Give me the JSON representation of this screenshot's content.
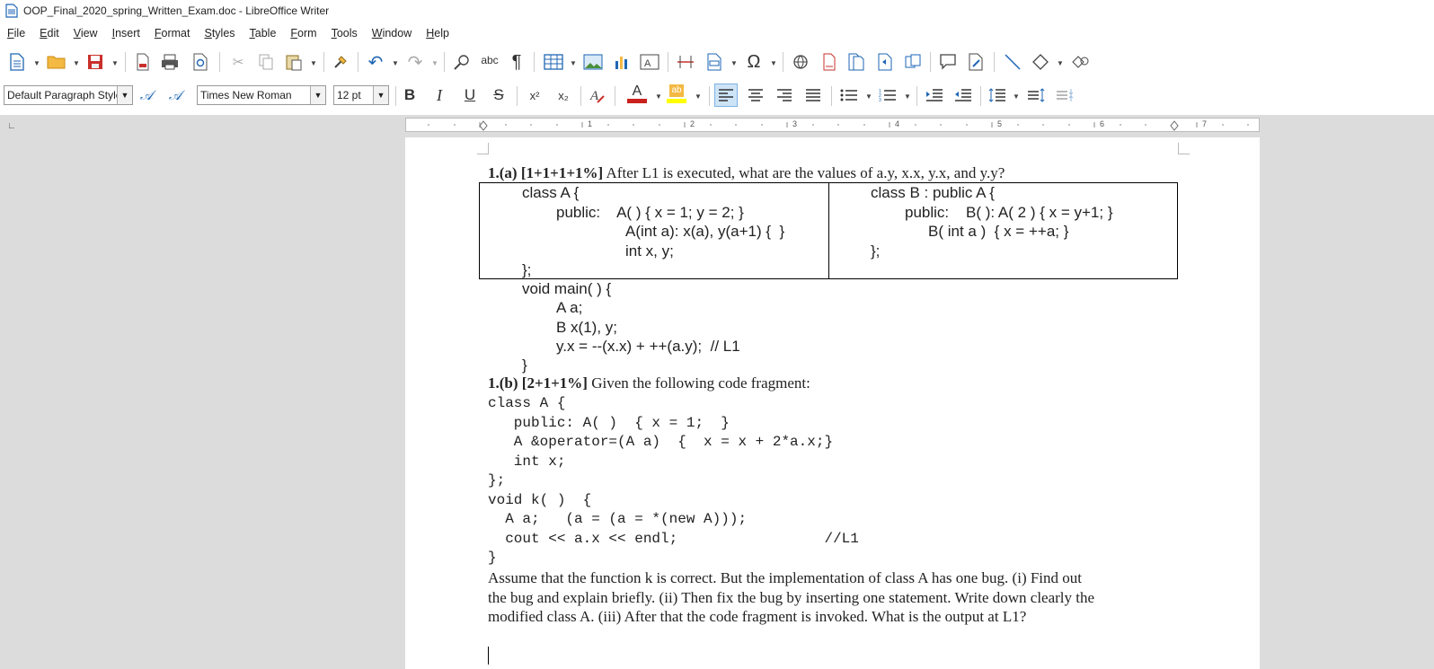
{
  "window": {
    "title": "OOP_Final_2020_spring_Written_Exam.doc - LibreOffice Writer"
  },
  "menu": [
    "File",
    "Edit",
    "View",
    "Insert",
    "Format",
    "Styles",
    "Table",
    "Form",
    "Tools",
    "Window",
    "Help"
  ],
  "formatting": {
    "paragraph_style": "Default Paragraph Style",
    "font_name": "Times New Roman",
    "font_size": "12 pt"
  },
  "toolbar_icons": {
    "bold": "B",
    "italic": "I",
    "underline": "U",
    "strikethrough": "S",
    "superscript": "x²",
    "subscript": "x₂",
    "font_color": "A",
    "highlight": "ab"
  },
  "ruler": {
    "numbers": [
      "1",
      "2",
      "3",
      "4",
      "5",
      "6",
      "7"
    ]
  },
  "document": {
    "q1a_heading": "1.(a) [1+1+1+1%]",
    "q1a_text": " After L1 is executed, what are the values of a.y, x.x, y.x, and y.y?",
    "classA": [
      "class A {",
      "public:    A( ) { x = 1; y = 2; }",
      "A(int a): x(a), y(a+1) {  }",
      "int x, y;",
      "};"
    ],
    "classB": [
      "class B : public A {",
      "public:    B( ): A( 2 ) { x = y+1; }",
      "B( int a )  { x = ++a; }",
      "};"
    ],
    "main": [
      "void main( ) {",
      "A a;",
      "B x(1), y;",
      "y.x = --(x.x) + ++(a.y);  // L1",
      "}"
    ],
    "q1b_heading": "1.(b) [2+1+1%]",
    "q1b_text": " Given the following code fragment:",
    "code": [
      "class A {",
      "   public: A( )  { x = 1;  }",
      "   A &operator=(A a)  {  x = x + 2*a.x;}",
      "   int x;",
      "};",
      "void k( )  {",
      "  A a;   (a = (a = *(new A)));",
      "  cout << a.x << endl;                 //L1",
      "}"
    ],
    "paragraph": [
      "Assume that the function k is correct. But the implementation of class A has one bug. (i) Find out",
      "the bug and explain briefly. (ii) Then fix the bug by inserting one statement. Write down clearly the",
      "modified class A. (iii) After that the code fragment is invoked. What is the output at L1?"
    ]
  }
}
